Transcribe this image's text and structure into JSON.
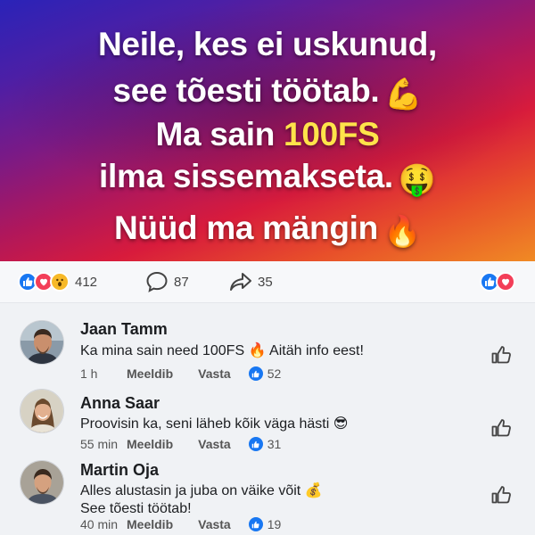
{
  "hero": {
    "line1": "Neile, kes ei uskunud,",
    "line2": "see tõesti töötab.",
    "line2_emoji": "💪",
    "line3_prefix": "Ma sain ",
    "line3_highlight": "100FS",
    "line4": "ilma sissemakseta.",
    "line4_emoji": "🤑",
    "line5": "Nüüd ma mängin",
    "line5_emoji": "🔥",
    "highlight_color": "#ffe34a"
  },
  "reactions": {
    "reaction_count": "412",
    "comment_count": "87",
    "share_count": "35",
    "icons": [
      "like-icon",
      "love-icon",
      "wow-icon",
      "comment-icon",
      "share-icon"
    ]
  },
  "comments": [
    {
      "name": "Jaan Tamm",
      "text": "Ka mina sain need 100FS 🔥 Aitäh info eest!",
      "time": "1 h",
      "like_label": "Meeldib",
      "reply_label": "Vasta",
      "likes": "52"
    },
    {
      "name": "Anna Saar",
      "text": "Proovisin ka, seni läheb kõik väga hästi 😎",
      "time": "55 min",
      "like_label": "Meeldib",
      "reply_label": "Vasta",
      "likes": "31"
    },
    {
      "name": "Martin Oja",
      "text": "Alles alustasin ja juba on väike võit 💰\nSee tõesti töötab!",
      "time": "40 min",
      "like_label": "Meeldib",
      "reply_label": "Vasta",
      "likes": "19"
    }
  ],
  "colors": {
    "accent": "#1877f2",
    "love": "#f33e58",
    "wow": "#f7b928",
    "background": "#f0f2f5"
  }
}
